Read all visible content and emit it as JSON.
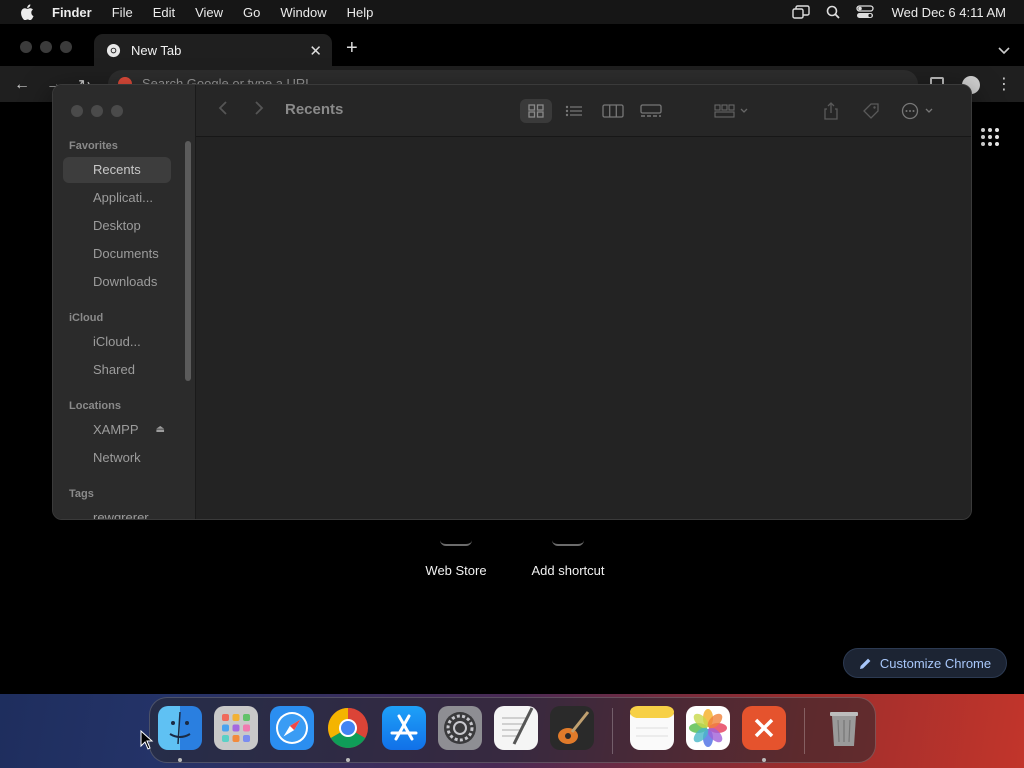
{
  "menubar": {
    "app_name": "Finder",
    "items": [
      "File",
      "Edit",
      "View",
      "Go",
      "Window",
      "Help"
    ],
    "clock": "Wed Dec 6  4:11 AM"
  },
  "chrome": {
    "tab_title": "New Tab",
    "omnibox_placeholder": "Search Google or type a URL",
    "shortcuts": [
      {
        "label": "Web Store"
      },
      {
        "label": "Add shortcut"
      }
    ],
    "customize_label": "Customize Chrome",
    "accent_color": "#a8c7fa"
  },
  "finder": {
    "title": "Recents",
    "sections": [
      {
        "title": "Favorites",
        "items": [
          {
            "label": "Recents",
            "selected": true
          },
          {
            "label": "Applicati..."
          },
          {
            "label": "Desktop"
          },
          {
            "label": "Documents"
          },
          {
            "label": "Downloads"
          }
        ]
      },
      {
        "title": "iCloud",
        "items": [
          {
            "label": "iCloud..."
          },
          {
            "label": "Shared"
          }
        ]
      },
      {
        "title": "Locations",
        "items": [
          {
            "label": "XAMPP",
            "ejectable": true
          },
          {
            "label": "Network"
          }
        ]
      },
      {
        "title": "Tags",
        "items": [
          {
            "label": "rewqrerer"
          }
        ]
      }
    ]
  },
  "dock": {
    "apps": [
      {
        "name": "Finder",
        "icon": "finder-icon",
        "running": true
      },
      {
        "name": "Launchpad",
        "icon": "launchpad-icon"
      },
      {
        "name": "Safari",
        "icon": "safari-icon"
      },
      {
        "name": "Google Chrome",
        "icon": "chrome-icon",
        "running": true
      },
      {
        "name": "App Store",
        "icon": "app-store-icon"
      },
      {
        "name": "System Settings",
        "icon": "system-settings-icon"
      },
      {
        "name": "TextEdit",
        "icon": "textedit-icon"
      },
      {
        "name": "GarageBand",
        "icon": "garageband-icon"
      },
      {
        "name": "Notes",
        "icon": "notes-icon"
      },
      {
        "name": "Photos",
        "icon": "photos-icon"
      },
      {
        "name": "Microsoft Remote Desktop",
        "icon": "remote-desktop-icon",
        "running": true
      },
      {
        "name": "Trash",
        "icon": "trash-icon"
      }
    ]
  }
}
